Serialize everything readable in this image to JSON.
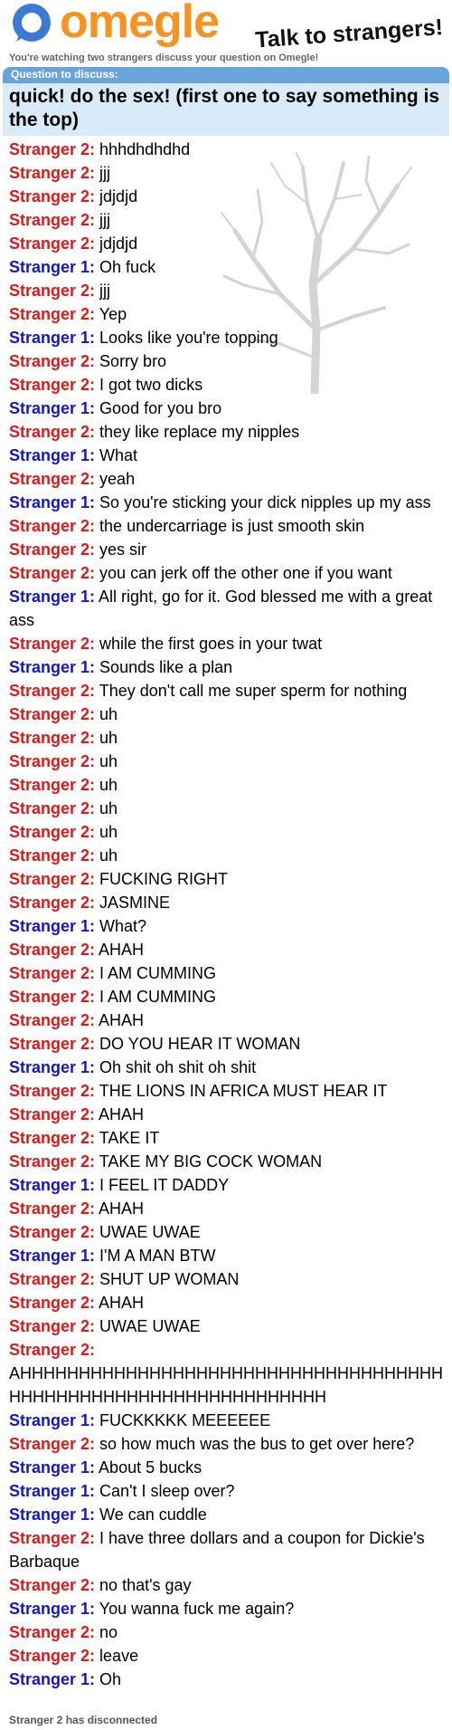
{
  "header": {
    "logo_text": "omegle",
    "tagline": "Talk to strangers!",
    "watching_text": "You're watching two strangers discuss your question on Omegle!"
  },
  "question": {
    "label": "Question to discuss:",
    "text": "quick! do the sex! (first one to say something is the top)"
  },
  "colors": {
    "stranger1": "#1515d0",
    "stranger2": "#e21818",
    "logo": "#f7931e",
    "question_bg": "#d9eaf8",
    "label_bg": "#69a3dc"
  },
  "messages": [
    {
      "who": "Stranger 2:",
      "s": 2,
      "text": "hhhdhdhdhd"
    },
    {
      "who": "Stranger 2:",
      "s": 2,
      "text": "jjj"
    },
    {
      "who": "Stranger 2:",
      "s": 2,
      "text": "jdjdjd"
    },
    {
      "who": "Stranger 2:",
      "s": 2,
      "text": "jjj"
    },
    {
      "who": "Stranger 2:",
      "s": 2,
      "text": "jdjdjd"
    },
    {
      "who": "Stranger 1:",
      "s": 1,
      "text": "Oh fuck"
    },
    {
      "who": "Stranger 2:",
      "s": 2,
      "text": "jjj"
    },
    {
      "who": "Stranger 2:",
      "s": 2,
      "text": "Yep"
    },
    {
      "who": "Stranger 1:",
      "s": 1,
      "text": "Looks like you're topping"
    },
    {
      "who": "Stranger 2:",
      "s": 2,
      "text": "Sorry bro"
    },
    {
      "who": "Stranger 2:",
      "s": 2,
      "text": "I got two dicks"
    },
    {
      "who": "Stranger 1:",
      "s": 1,
      "text": "Good for you bro"
    },
    {
      "who": "Stranger 2:",
      "s": 2,
      "text": "they like replace my nipples"
    },
    {
      "who": "Stranger 1:",
      "s": 1,
      "text": "What"
    },
    {
      "who": "Stranger 2:",
      "s": 2,
      "text": "yeah"
    },
    {
      "who": "Stranger 1:",
      "s": 1,
      "text": "So you're sticking your dick nipples up my ass"
    },
    {
      "who": "Stranger 2:",
      "s": 2,
      "text": "the undercarriage is just smooth skin"
    },
    {
      "who": "Stranger 2:",
      "s": 2,
      "text": "yes sir"
    },
    {
      "who": "Stranger 2:",
      "s": 2,
      "text": "you can jerk off the other one if you want"
    },
    {
      "who": "Stranger 1:",
      "s": 1,
      "text": "All right, go for it. God blessed me with a great ass"
    },
    {
      "who": "Stranger 2:",
      "s": 2,
      "text": "while the first goes in your twat"
    },
    {
      "who": "Stranger 1:",
      "s": 1,
      "text": "Sounds like a plan"
    },
    {
      "who": "Stranger 2:",
      "s": 2,
      "text": "They don't call me super sperm for nothing"
    },
    {
      "who": "Stranger 2:",
      "s": 2,
      "text": "uh"
    },
    {
      "who": "Stranger 2:",
      "s": 2,
      "text": "uh"
    },
    {
      "who": "Stranger 2:",
      "s": 2,
      "text": "uh"
    },
    {
      "who": "Stranger 2:",
      "s": 2,
      "text": "uh"
    },
    {
      "who": "Stranger 2:",
      "s": 2,
      "text": "uh"
    },
    {
      "who": "Stranger 2:",
      "s": 2,
      "text": "uh"
    },
    {
      "who": "Stranger 2:",
      "s": 2,
      "text": "uh"
    },
    {
      "who": "Stranger 2:",
      "s": 2,
      "text": "FUCKING RIGHT"
    },
    {
      "who": "Stranger 2:",
      "s": 2,
      "text": "JASMINE"
    },
    {
      "who": "Stranger 1:",
      "s": 1,
      "text": "What?"
    },
    {
      "who": "Stranger 2:",
      "s": 2,
      "text": "AHAH"
    },
    {
      "who": "Stranger 2:",
      "s": 2,
      "text": "I AM CUMMING"
    },
    {
      "who": "Stranger 2:",
      "s": 2,
      "text": "I AM CUMMING"
    },
    {
      "who": "Stranger 2:",
      "s": 2,
      "text": "AHAH"
    },
    {
      "who": "Stranger 2:",
      "s": 2,
      "text": "DO YOU HEAR IT WOMAN"
    },
    {
      "who": "Stranger 1:",
      "s": 1,
      "text": "Oh shit oh shit oh shit"
    },
    {
      "who": "Stranger 2:",
      "s": 2,
      "text": "THE LIONS IN AFRICA MUST HEAR IT"
    },
    {
      "who": "Stranger 2:",
      "s": 2,
      "text": "AHAH"
    },
    {
      "who": "Stranger 2:",
      "s": 2,
      "text": "TAKE IT"
    },
    {
      "who": "Stranger 2:",
      "s": 2,
      "text": "TAKE MY BIG COCK WOMAN"
    },
    {
      "who": "Stranger 1:",
      "s": 1,
      "text": "I FEEL IT DADDY"
    },
    {
      "who": "Stranger 2:",
      "s": 2,
      "text": "AHAH"
    },
    {
      "who": "Stranger 2:",
      "s": 2,
      "text": "UWAE UWAE"
    },
    {
      "who": "Stranger 1:",
      "s": 1,
      "text": "I'M A MAN BTW"
    },
    {
      "who": "Stranger 2:",
      "s": 2,
      "text": "SHUT UP WOMAN"
    },
    {
      "who": "Stranger 2:",
      "s": 2,
      "text": "AHAH"
    },
    {
      "who": "Stranger 2:",
      "s": 2,
      "text": "UWAE UWAE"
    },
    {
      "who": "Stranger 2:",
      "s": 2,
      "text": "AHHHHHHHHHHHHHHHHHHHHHHHHHHHHHHHHHHHHHHHHHHHHHHHHHHHHHHHHHHHHHHH"
    },
    {
      "who": "Stranger 1:",
      "s": 1,
      "text": "FUCKKKKK MEEEEEE"
    },
    {
      "who": "Stranger 2:",
      "s": 2,
      "text": "so how much was the bus to get over here?"
    },
    {
      "who": "Stranger 1:",
      "s": 1,
      "text": "About 5 bucks"
    },
    {
      "who": "Stranger 1:",
      "s": 1,
      "text": "Can't I sleep over?"
    },
    {
      "who": "Stranger 1:",
      "s": 1,
      "text": "We can cuddle"
    },
    {
      "who": "Stranger 2:",
      "s": 2,
      "text": "I have three dollars and a coupon for Dickie's Barbaque"
    },
    {
      "who": "Stranger 2:",
      "s": 2,
      "text": "no that's gay"
    },
    {
      "who": "Stranger 1:",
      "s": 1,
      "text": "You wanna fuck me again?"
    },
    {
      "who": "Stranger 2:",
      "s": 2,
      "text": "no"
    },
    {
      "who": "Stranger 2:",
      "s": 2,
      "text": "leave"
    },
    {
      "who": "Stranger 1:",
      "s": 1,
      "text": "Oh"
    }
  ],
  "status_text": "Stranger 2 has disconnected"
}
